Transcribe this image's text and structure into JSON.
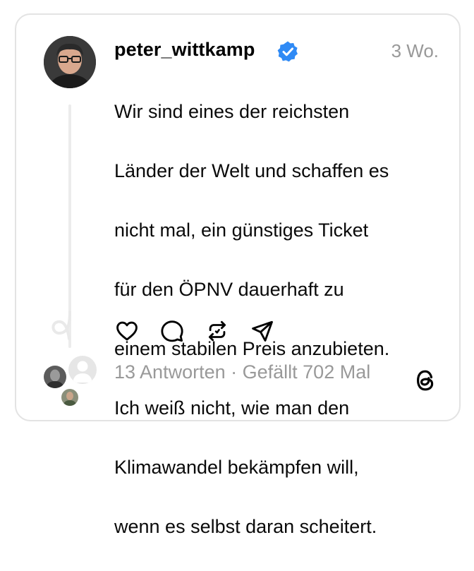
{
  "post": {
    "username": "peter_wittkamp",
    "time": "3 Wo.",
    "text_lines": [
      "Wir sind eines der reichsten",
      "Länder der Welt und schaffen es",
      "nicht mal, ein günstiges Ticket",
      "für den ÖPNV dauerhaft zu",
      "einem stabilen Preis anzubieten.",
      "Ich weiß nicht, wie man den",
      "Klimawandel bekämpfen will,",
      "wenn es selbst daran scheitert."
    ]
  },
  "footer": {
    "replies": "13 Antworten",
    "separator": " · ",
    "likes": "Gefällt 702 Mal"
  },
  "icons": {
    "verified": "verified-badge-icon",
    "like": "heart-icon",
    "reply": "comment-bubble-icon",
    "repost": "repost-icon",
    "share": "send-paper-plane-icon",
    "brand": "threads-logo-icon"
  },
  "colors": {
    "verified": "#2f8af5",
    "muted_text": "#999999",
    "border": "#e3e3e3",
    "thread_line": "#ececec"
  }
}
